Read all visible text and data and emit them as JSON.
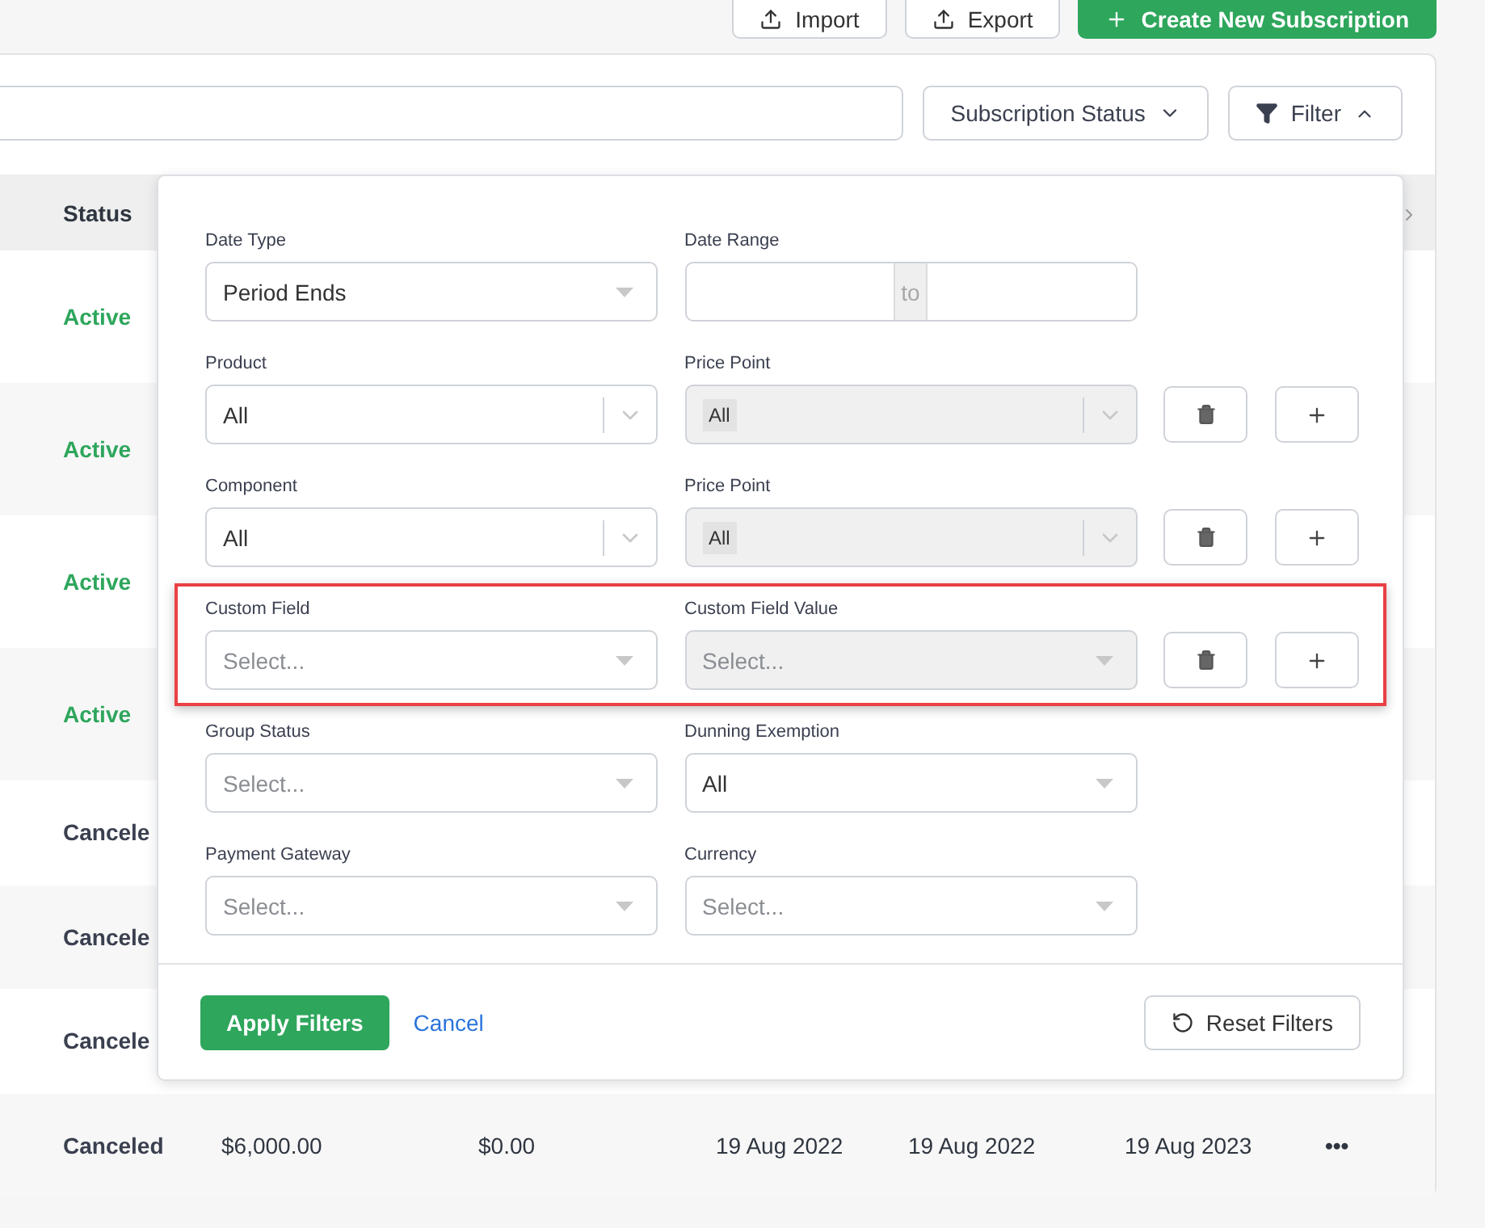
{
  "top_buttons": [
    {
      "label": "Import",
      "kind": "outline"
    },
    {
      "label": "Export",
      "kind": "outline"
    },
    {
      "label": "Create New Subscription",
      "kind": "primary"
    }
  ],
  "toolbar": {
    "status_button": "Subscription Status",
    "filter_button": "Filter",
    "filter_open": true
  },
  "table": {
    "columns": [
      "Status"
    ],
    "rows": [
      {
        "status": "Active",
        "kind": "active"
      },
      {
        "status": "Active",
        "kind": "active"
      },
      {
        "status": "Active",
        "kind": "active"
      },
      {
        "status": "Active",
        "kind": "active"
      },
      {
        "status": "Cancele",
        "kind": "canceled"
      },
      {
        "status": "Cancele",
        "kind": "canceled"
      },
      {
        "status": "Cancele",
        "kind": "canceled"
      },
      {
        "status": "Canceled",
        "kind": "canceled",
        "cells": [
          "$6,000.00",
          "$0.00",
          "19 Aug 2022",
          "19 Aug 2022",
          "19 Aug 2023"
        ],
        "menu": "•••"
      }
    ]
  },
  "filter_panel": {
    "rows": [
      {
        "highlighted": false,
        "fields": [
          {
            "label": "Date Type",
            "kind": "select",
            "value": "Period Ends"
          },
          {
            "label": "Date Range",
            "kind": "daterange",
            "separator": "to"
          }
        ]
      },
      {
        "highlighted": false,
        "actions": true,
        "fields": [
          {
            "label": "Product",
            "kind": "multi",
            "value": "All"
          },
          {
            "label": "Price Point",
            "kind": "multi",
            "value": "All",
            "disabled": true
          }
        ]
      },
      {
        "highlighted": false,
        "actions": true,
        "fields": [
          {
            "label": "Component",
            "kind": "multi",
            "value": "All"
          },
          {
            "label": "Price Point",
            "kind": "multi",
            "value": "All",
            "disabled": true
          }
        ]
      },
      {
        "highlighted": true,
        "actions": true,
        "fields": [
          {
            "label": "Custom Field",
            "kind": "select",
            "placeholder": "Select..."
          },
          {
            "label": "Custom Field Value",
            "kind": "select",
            "placeholder": "Select...",
            "disabled": true
          }
        ]
      },
      {
        "highlighted": false,
        "fields": [
          {
            "label": "Group Status",
            "kind": "select",
            "placeholder": "Select..."
          },
          {
            "label": "Dunning Exemption",
            "kind": "select",
            "value": "All"
          }
        ]
      },
      {
        "highlighted": false,
        "fields": [
          {
            "label": "Payment Gateway",
            "kind": "select",
            "placeholder": "Select..."
          },
          {
            "label": "Currency",
            "kind": "select",
            "placeholder": "Select..."
          }
        ]
      }
    ],
    "apply": "Apply Filters",
    "cancel": "Cancel",
    "reset": "Reset Filters"
  }
}
